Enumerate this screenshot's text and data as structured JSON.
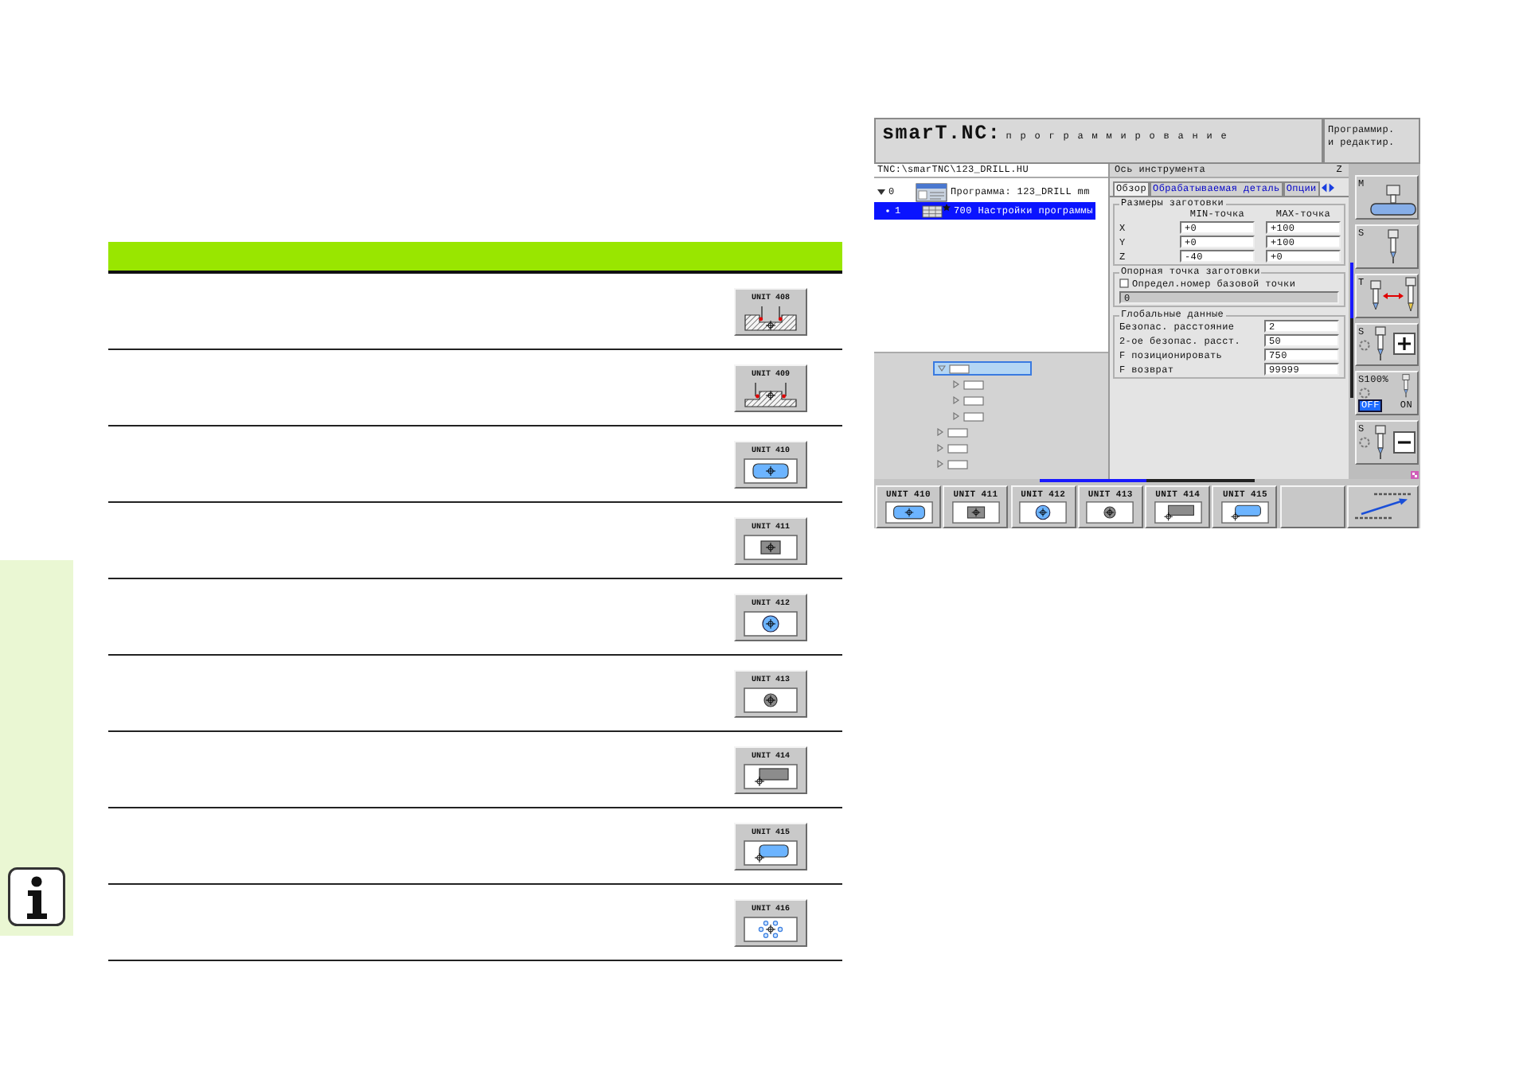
{
  "table": {
    "rows": [
      {
        "key": "UNIT 408",
        "kind": "slot"
      },
      {
        "key": "UNIT 409",
        "kind": "ridge"
      },
      {
        "key": "UNIT 410",
        "kind": "pocket"
      },
      {
        "key": "UNIT 411",
        "kind": "stud"
      },
      {
        "key": "UNIT 412",
        "kind": "bore"
      },
      {
        "key": "UNIT 413",
        "kind": "boss"
      },
      {
        "key": "UNIT 414",
        "kind": "outercorner"
      },
      {
        "key": "UNIT 415",
        "kind": "innercorner"
      },
      {
        "key": "UNIT 416",
        "kind": "boltcircle"
      }
    ]
  },
  "screenshot": {
    "title": {
      "app": "smarT.NC:",
      "mode": "программирование"
    },
    "mode_box": "Программир. и редактир.",
    "path": "TNC:\\smarTNC\\123_DRILL.HU",
    "program_tree": [
      {
        "number": "0",
        "kind": "program",
        "label": "Программа: 123_DRILL mm",
        "expanded": true,
        "selected": false,
        "children": [
          {
            "number": "1",
            "kind": "settings",
            "label": "700 Настройки программы",
            "selected": true
          }
        ]
      }
    ],
    "structure_tree": [
      {
        "expanded": true,
        "selected": true,
        "children": [
          {
            "expanded": false,
            "selected": false
          },
          {
            "expanded": false,
            "selected": false
          },
          {
            "expanded": false,
            "selected": false
          }
        ]
      },
      {
        "expanded": false,
        "selected": false
      },
      {
        "expanded": false,
        "selected": false
      },
      {
        "expanded": false,
        "selected": false
      }
    ],
    "form": {
      "tool_axis": {
        "label": "Ось инструмента",
        "value": "Z"
      },
      "tabs": [
        {
          "label": "Обзор",
          "selected": true
        },
        {
          "label": "Обрабатываемая деталь",
          "selected": false
        },
        {
          "label": "Опции",
          "selected": false
        }
      ],
      "blank_size": {
        "title": "Размеры заготовки",
        "columns": [
          "MIN-точка",
          "MAX-точка"
        ],
        "rows": [
          {
            "axis": "X",
            "min": "+0",
            "max": "+100"
          },
          {
            "axis": "Y",
            "min": "+0",
            "max": "+100"
          },
          {
            "axis": "Z",
            "min": "-40",
            "max": "+0"
          }
        ]
      },
      "datum": {
        "title": "Опорная точка заготовки",
        "checkbox": {
          "label": "Определ.номер базовой точки",
          "checked": false
        },
        "field": {
          "value": "0",
          "disabled": true
        }
      },
      "global_data": {
        "title": "Глобальные данные",
        "rows": [
          {
            "label": "Безопас. расстояние",
            "value": "2"
          },
          {
            "label": "2-ое безопас. расст.",
            "value": "50"
          },
          {
            "label": "F позиционировать",
            "value": "750"
          },
          {
            "label": "F возврат",
            "value": "99999"
          }
        ]
      }
    },
    "side_softkeys": [
      {
        "kind": "machine",
        "label": "M"
      },
      {
        "kind": "spindle",
        "label": "S"
      },
      {
        "kind": "tool",
        "label": "T"
      },
      {
        "kind": "increase",
        "label": "S"
      },
      {
        "kind": "override",
        "label": "S100%",
        "options": [
          {
            "label": "OFF",
            "selected": true
          },
          {
            "label": "ON",
            "selected": false
          }
        ]
      },
      {
        "kind": "decrease",
        "label": "S"
      }
    ],
    "softkeys": [
      {
        "kind": "pocket",
        "label": "UNIT 410"
      },
      {
        "kind": "stud",
        "label": "UNIT 411"
      },
      {
        "kind": "bore",
        "label": "UNIT 412"
      },
      {
        "kind": "boss",
        "label": "UNIT 413"
      },
      {
        "kind": "outercorner",
        "label": "UNIT 414"
      },
      {
        "kind": "innercorner",
        "label": "UNIT 415"
      },
      {
        "kind": "empty"
      },
      {
        "kind": "nextrow"
      }
    ]
  }
}
